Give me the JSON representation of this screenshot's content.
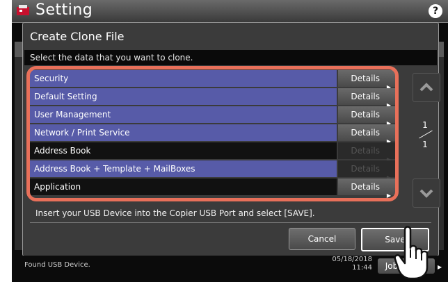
{
  "header": {
    "title": "Setting",
    "help_label": "?"
  },
  "dialog": {
    "title": "Create Clone File",
    "instruction": "Select the data that you want to clone.",
    "rows": [
      {
        "label": "Security",
        "details": "Details",
        "selected": true,
        "details_enabled": true
      },
      {
        "label": "Default Setting",
        "details": "Details",
        "selected": true,
        "details_enabled": true
      },
      {
        "label": "User Management",
        "details": "Details",
        "selected": true,
        "details_enabled": true
      },
      {
        "label": "Network / Print Service",
        "details": "Details",
        "selected": true,
        "details_enabled": true
      },
      {
        "label": "Address Book",
        "details": "Details",
        "selected": false,
        "details_enabled": false
      },
      {
        "label": "Address Book + Template + MailBoxes",
        "details": "Details",
        "selected": true,
        "details_enabled": false
      },
      {
        "label": "Application",
        "details": "Details",
        "selected": false,
        "details_enabled": true
      }
    ],
    "page_current": "1",
    "page_total": "1",
    "usb_note": "Insert your USB Device into the Copier USB Port and select [SAVE].",
    "cancel_label": "Cancel",
    "save_label": "Save"
  },
  "status": {
    "message": "Found USB Device.",
    "date": "05/18/2018",
    "time": "11:44",
    "job_label": "Job Status"
  },
  "colors": {
    "selected_row": "#575ba8",
    "highlight_outline": "#e8705a"
  }
}
